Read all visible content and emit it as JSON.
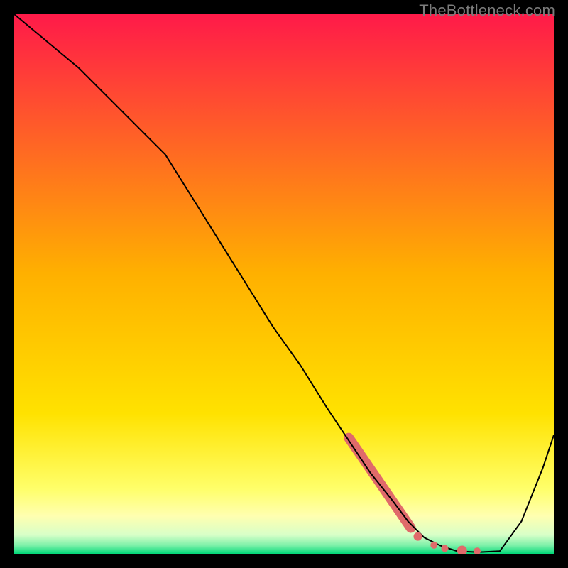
{
  "watermark": "TheBottleneck.com",
  "chart_data": {
    "type": "line",
    "title": "",
    "xlabel": "",
    "ylabel": "",
    "xlim": [
      0,
      100
    ],
    "ylim": [
      0,
      100
    ],
    "grid": false,
    "annotations": [],
    "background_gradient": {
      "top_color": "#ff1a49",
      "mid_color": "#ffd400",
      "near_bottom_color": "#ffff8a",
      "bottom_color": "#00e47a"
    },
    "series": [
      {
        "name": "bottleneck-curve",
        "color": "#000000",
        "stroke_width": 2,
        "x": [
          0,
          6,
          12,
          18,
          24,
          28,
          33,
          38,
          43,
          48,
          53,
          58,
          62,
          66,
          70,
          73,
          76,
          79,
          82,
          86,
          90,
          94,
          98,
          100
        ],
        "y": [
          100,
          95,
          90,
          84,
          78,
          74,
          66,
          58,
          50,
          42,
          35,
          27,
          21,
          15,
          10,
          6,
          3,
          1.5,
          0.5,
          0.3,
          0.5,
          6,
          16,
          22
        ]
      }
    ],
    "highlight_segments": [
      {
        "name": "thick-diagonal",
        "color": "#e06a6a",
        "stroke_width": 14,
        "linecap": "round",
        "x": [
          62,
          73.5
        ],
        "y": [
          21.5,
          4.8
        ]
      }
    ],
    "dots": [
      {
        "name": "dot-1",
        "x": 74.8,
        "y": 3.2,
        "r": 6,
        "color": "#e06a6a"
      },
      {
        "name": "dot-2",
        "x": 77.8,
        "y": 1.6,
        "r": 5,
        "color": "#e06a6a"
      },
      {
        "name": "dot-3",
        "x": 79.8,
        "y": 1.0,
        "r": 5,
        "color": "#e06a6a"
      },
      {
        "name": "dot-4",
        "x": 83.0,
        "y": 0.6,
        "r": 7,
        "color": "#e06a6a"
      },
      {
        "name": "dot-5",
        "x": 85.8,
        "y": 0.5,
        "r": 5,
        "color": "#e06a6a"
      }
    ]
  }
}
